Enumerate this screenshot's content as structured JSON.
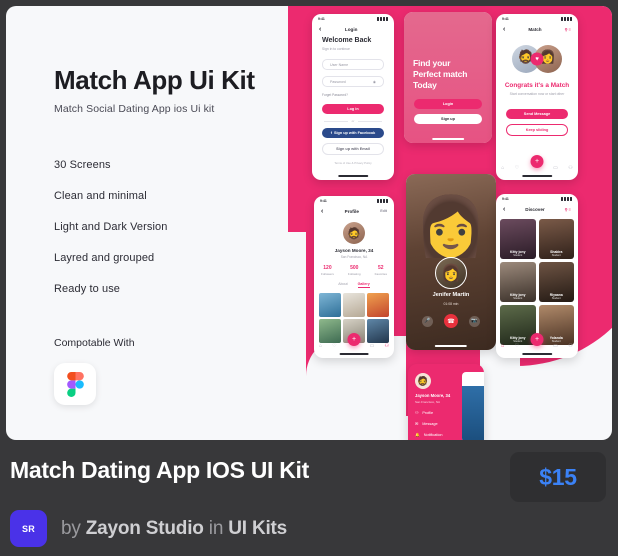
{
  "preview": {
    "kit": {
      "title": "Match App Ui Kit",
      "subtitle": "Match  Social Dating App ios Ui kit",
      "features": [
        "30 Screens",
        "Clean and minimal",
        "Light and Dark Version",
        "Layred and grouped",
        "Ready to use"
      ],
      "compatible_label": "Compotable With",
      "compatible_tool": "figma-logo"
    },
    "accent_pink": "#ec2a6f",
    "phones": {
      "login": {
        "status_time": "9:41",
        "nav_title": "Login",
        "heading": "Welcome Back",
        "subheading": "Sign in to continue",
        "username_placeholder": "User Name",
        "password_placeholder": "Password",
        "forgot_label": "Forget Password?",
        "login_button": "Log in",
        "divider_label": "or",
        "facebook_button": "Sign up with Facebook",
        "email_button": "Sign up with Email",
        "terms": "Terms of Use & Privacy Policy"
      },
      "onboarding": {
        "headline": "Find your\nPerfect match\nToday",
        "login_button": "Login",
        "signup_button": "Sign up"
      },
      "match": {
        "status_time": "9:41",
        "nav_title": "Match",
        "heading": "Congrats it's a Match",
        "subheading": "Start conversation now or start other",
        "primary_button": "Send Message",
        "secondary_button": "Keep sliding"
      },
      "profile": {
        "status_time": "9:41",
        "nav_title": "Profile",
        "edit_label": "Edit",
        "name": "Jayson Moore, 34",
        "location": "San Francisco, NA",
        "stats": [
          {
            "value": "120",
            "label": "Followers"
          },
          {
            "value": "500",
            "label": "Following"
          },
          {
            "value": "52",
            "label": "Favorites"
          }
        ],
        "tabs": [
          "About",
          "Gallery"
        ],
        "active_tab": "Gallery"
      },
      "call": {
        "name": "Jenifer Martin",
        "duration": "01:08 min"
      },
      "discover": {
        "status_time": "9:41",
        "nav_title": "Discover",
        "cards": [
          {
            "name": "Kitty jony",
            "sub": "Student"
          },
          {
            "name": "Shakira",
            "sub": "Student"
          },
          {
            "name": "Kitty jony",
            "sub": "Student"
          },
          {
            "name": "Riyaana",
            "sub": "Student"
          },
          {
            "name": "Kitty jony",
            "sub": "Student"
          },
          {
            "name": "Yolanda",
            "sub": "Student"
          }
        ]
      },
      "drawer": {
        "name": "Jayson Moore, 34",
        "location": "San Francisco, NA",
        "items": [
          "Profile",
          "Message",
          "Notification"
        ]
      }
    }
  },
  "listing": {
    "title": "Match Dating App IOS UI Kit",
    "price": "$15",
    "price_color": "#3b82f6",
    "author_initials": "SR",
    "by_label": "by",
    "author_name": "Zayon Studio",
    "in_label": "in",
    "category": "UI Kits"
  }
}
